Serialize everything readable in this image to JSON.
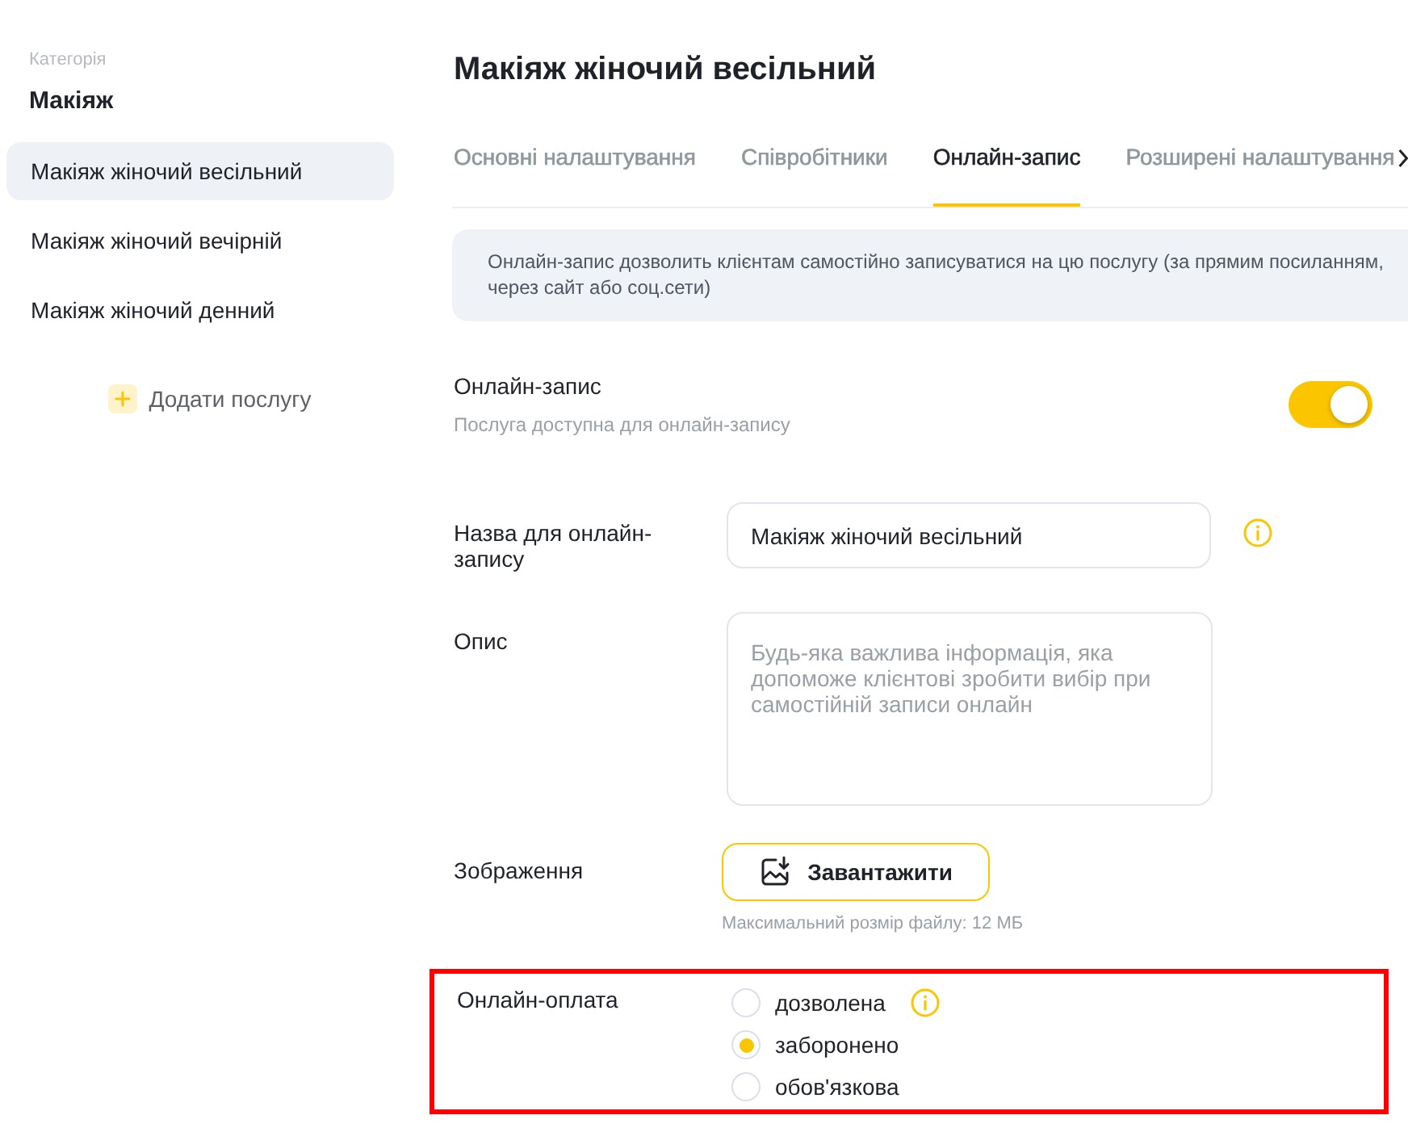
{
  "sidebar": {
    "category_label": "Категорія",
    "category": "Макіяж",
    "items": [
      {
        "label": "Макіяж жіночий весільний",
        "selected": true
      },
      {
        "label": "Макіяж жіночий вечірній",
        "selected": false
      },
      {
        "label": "Макіяж жіночий денний",
        "selected": false
      }
    ],
    "add_button": "Додати послугу"
  },
  "page": {
    "title": "Макіяж жіночий весільний",
    "tabs": [
      {
        "label": "Основні налаштування",
        "selected": false
      },
      {
        "label": "Співробітники",
        "selected": false
      },
      {
        "label": "Онлайн-запис",
        "selected": true
      },
      {
        "label": "Розширені налаштування",
        "selected": false
      }
    ],
    "info": "Онлайн-запис дозволить клієнтам самостійно записуватися на цю послугу (за прямим посиланням, через сайт або соц.сети)"
  },
  "online_booking": {
    "label": "Онлайн-запис",
    "hint": "Послуга доступна для онлайн-запису",
    "on": true
  },
  "form": {
    "name": {
      "label": "Назва для онлайн-запису",
      "value": "Макіяж жіночий весільний",
      "info": true
    },
    "description": {
      "label": "Опис",
      "placeholder": "Будь-яка важлива інформація, яка допоможе клієнтові зробити вибір при самостійній записи онлайн"
    },
    "image": {
      "label": "Зображення",
      "button": "Завантажити",
      "hint": "Максимальний розмір файлу: 12 МБ"
    }
  },
  "online_payment": {
    "label": "Онлайн-оплата",
    "highlighted": true,
    "options": [
      {
        "label": "дозволена",
        "selected": false,
        "info": true
      },
      {
        "label": "заборонено",
        "selected": true,
        "info": false
      },
      {
        "label": "обов'язкова",
        "selected": false,
        "info": false
      }
    ]
  }
}
